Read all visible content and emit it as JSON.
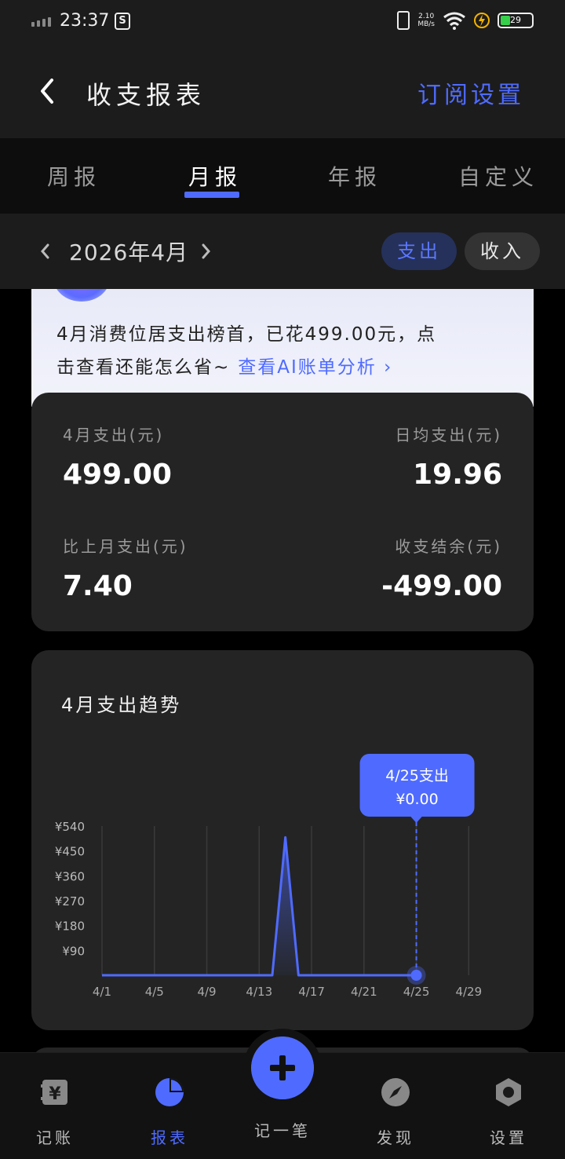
{
  "status_bar": {
    "time": "23:37",
    "app_badge": "S",
    "net_speed_value": "2.10",
    "net_speed_unit": "MB/s",
    "battery": "29"
  },
  "header": {
    "title": "收支报表",
    "action_label": "订阅设置"
  },
  "tabs": [
    "周报",
    "月报",
    "年报",
    "自定义"
  ],
  "active_tab": "月报",
  "date_row": {
    "label": "2026年4月",
    "expense_toggle": "支出",
    "income_toggle": "收入"
  },
  "ai_banner": {
    "line1": "4月消费位居支出榜首，已花499.00元，点",
    "line2": "击查看还能怎么省~",
    "link": "查看AI账单分析 ›"
  },
  "summary": {
    "month_expense_label": "4月支出(元)",
    "month_expense_value": "499.00",
    "daily_avg_label": "日均支出(元)",
    "daily_avg_value": "19.96",
    "vs_last_month_label": "比上月支出(元)",
    "vs_last_month_value": "7.40",
    "balance_label": "收支结余(元)",
    "balance_value": "-499.00"
  },
  "chart_data": {
    "type": "line",
    "title": "4月支出趋势",
    "x_tick_labels": [
      "4/1",
      "4/5",
      "4/9",
      "4/13",
      "4/17",
      "4/21",
      "4/25",
      "4/29"
    ],
    "x_tick_days": [
      1,
      5,
      9,
      13,
      17,
      21,
      25,
      29
    ],
    "y_tick_labels": [
      "¥90",
      "¥180",
      "¥270",
      "¥360",
      "¥450",
      "¥540"
    ],
    "y_tick_values": [
      90,
      180,
      270,
      360,
      450,
      540
    ],
    "ylim": [
      0,
      540
    ],
    "xlim": [
      1,
      30
    ],
    "series": [
      {
        "x": [
          1,
          2,
          3,
          4,
          5,
          6,
          7,
          8,
          9,
          10,
          11,
          12,
          13,
          14,
          15,
          16,
          17,
          18,
          19,
          20,
          21,
          22,
          23,
          24,
          25
        ],
        "values": [
          0,
          0,
          0,
          0,
          0,
          0,
          0,
          0,
          0,
          0,
          0,
          0,
          0,
          0,
          499,
          0,
          0,
          0,
          0,
          0,
          0,
          0,
          0,
          0,
          0
        ]
      }
    ],
    "tooltip": {
      "x": 25,
      "title": "4/25支出",
      "value_label": "¥0.00"
    },
    "colors": {
      "line": "#4f6bff",
      "grid": "#3a3a3a",
      "tooltip": "#4f6bff"
    },
    "grid": true
  },
  "bottom_nav": {
    "items": [
      {
        "label": "记账",
        "icon": "ledger-icon"
      },
      {
        "label": "报表",
        "icon": "pie-chart-icon"
      },
      {
        "label": "发现",
        "icon": "compass-icon"
      },
      {
        "label": "设置",
        "icon": "settings-hex-icon"
      }
    ],
    "fab_label": "记一笔",
    "active": "报表"
  }
}
